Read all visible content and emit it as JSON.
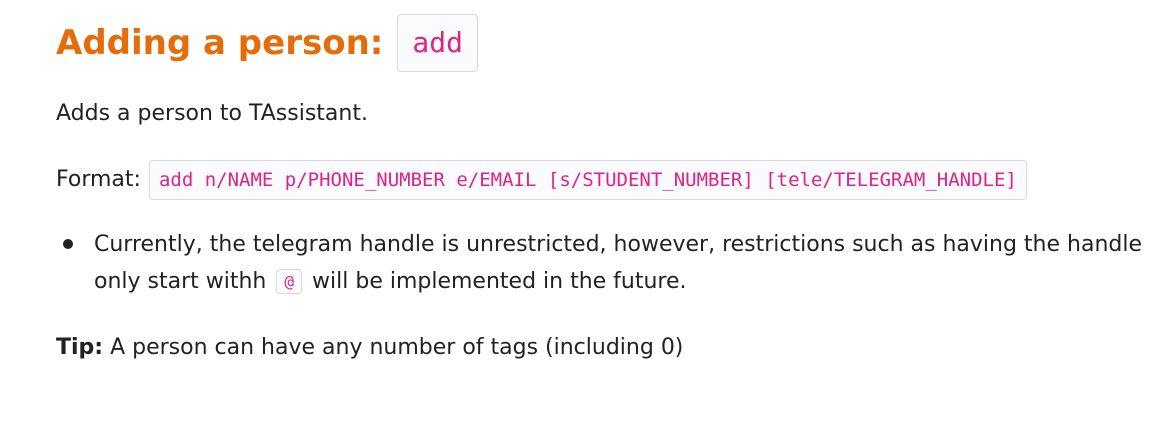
{
  "section": {
    "heading_text": "Adding a person:",
    "heading_code": "add"
  },
  "description": "Adds a person to TAssistant.",
  "format": {
    "label": "Format:",
    "code": "add n/NAME p/PHONE_NUMBER e/EMAIL [s/STUDENT_NUMBER] [tele/TELEGRAM_HANDLE]"
  },
  "notes": [
    {
      "text_before": "Currently, the telegram handle is unrestricted, however, restrictions such as having the handle only start withh",
      "code": "@",
      "text_after": "will be implemented in the future."
    }
  ],
  "tip": {
    "label": "Tip:",
    "text": "A person can have any number of tags (including 0)"
  },
  "colors": {
    "heading": "#e46c0a",
    "code_text": "#e0218a",
    "code_border": "#d6d8de",
    "body_text": "#222222"
  }
}
